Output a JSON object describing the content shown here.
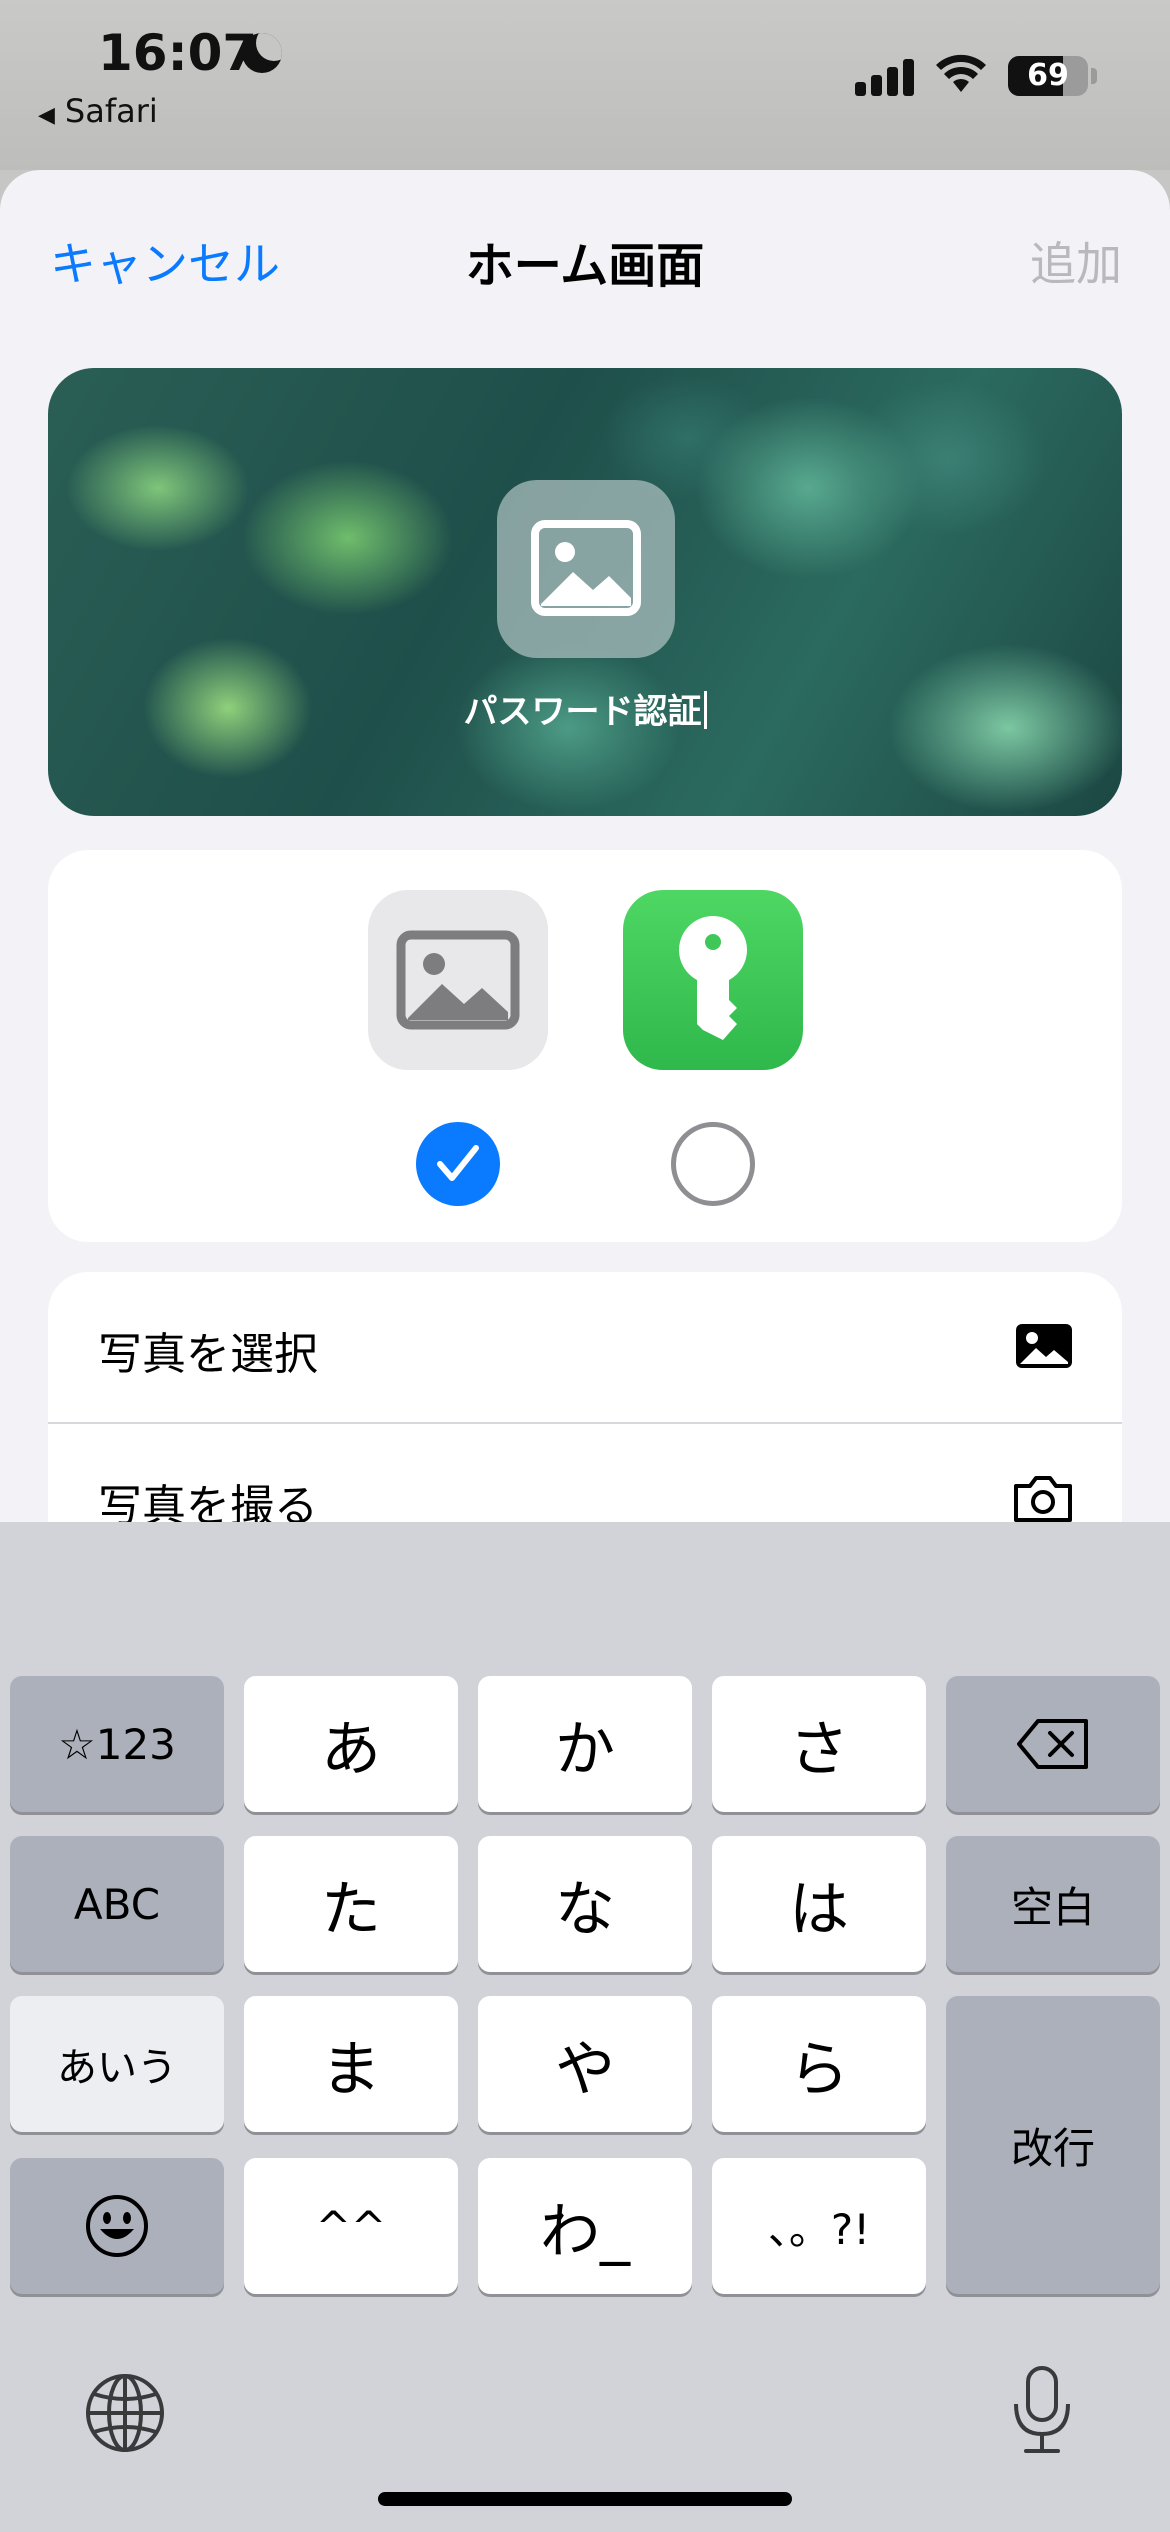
{
  "status_bar": {
    "time": "16:07",
    "back_app": "Safari",
    "battery": "69",
    "battery_level": 0.69
  },
  "nav": {
    "cancel": "キャンセル",
    "title": "ホーム画面",
    "add": "追加"
  },
  "preview": {
    "name": "パスワード認証"
  },
  "icon_options": [
    {
      "icon": "photo-icon",
      "selected": true
    },
    {
      "icon": "key-icon",
      "selected": false
    }
  ],
  "list": {
    "choose_photo": "写真を選択",
    "take_photo": "写真を撮る"
  },
  "keyboard": {
    "row1": [
      "☆123",
      "あ",
      "か",
      "さ"
    ],
    "row2": [
      "ABC",
      "た",
      "な",
      "は",
      "空白"
    ],
    "row3": [
      "あいう",
      "ま",
      "や",
      "ら"
    ],
    "row4": [
      "^^",
      "わ_",
      "、。?!"
    ],
    "return": "改行"
  },
  "colors": {
    "accent": "#0a7aff",
    "key_green": "#34c759",
    "disabled": "#b9b9bd"
  }
}
